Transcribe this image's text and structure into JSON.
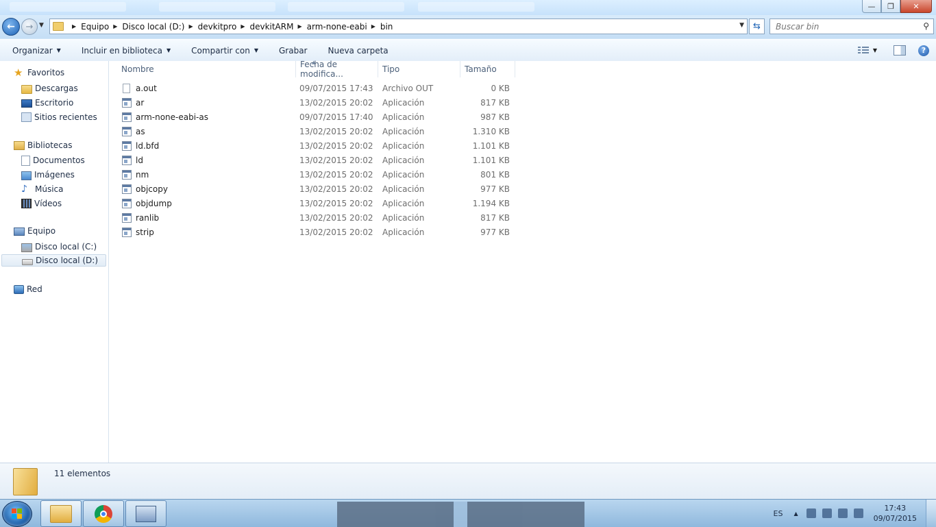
{
  "window": {
    "controls": {
      "minimize": "—",
      "maximize": "❐",
      "close": "✕"
    }
  },
  "nav": {
    "back_glyph": "←",
    "forward_glyph": "→",
    "breadcrumb": [
      "Equipo",
      "Disco local (D:)",
      "devkitpro",
      "devkitARM",
      "arm-none-eabi",
      "bin"
    ],
    "search_placeholder": "Buscar bin"
  },
  "toolbar": {
    "organize": "Organizar",
    "include_library": "Incluir en biblioteca",
    "share_with": "Compartir con",
    "burn": "Grabar",
    "new_folder": "Nueva carpeta",
    "help": "?"
  },
  "sidebar": {
    "favorites": {
      "label": "Favoritos",
      "items": [
        "Descargas",
        "Escritorio",
        "Sitios recientes"
      ]
    },
    "libraries": {
      "label": "Bibliotecas",
      "items": [
        "Documentos",
        "Imágenes",
        "Música",
        "Vídeos"
      ]
    },
    "computer": {
      "label": "Equipo",
      "items": [
        "Disco local (C:)",
        "Disco local (D:)"
      ],
      "selected": "Disco local (D:)"
    },
    "network": {
      "label": "Red"
    }
  },
  "columns": {
    "name": "Nombre",
    "date": "Fecha de modifica...",
    "type": "Tipo",
    "size": "Tamaño"
  },
  "files": [
    {
      "name": "a.out",
      "date": "09/07/2015 17:43",
      "type": "Archivo OUT",
      "size": "0 KB",
      "icon": "file-icon"
    },
    {
      "name": "ar",
      "date": "13/02/2015 20:02",
      "type": "Aplicación",
      "size": "817 KB",
      "icon": "application-icon"
    },
    {
      "name": "arm-none-eabi-as",
      "date": "09/07/2015 17:40",
      "type": "Aplicación",
      "size": "987 KB",
      "icon": "application-icon"
    },
    {
      "name": "as",
      "date": "13/02/2015 20:02",
      "type": "Aplicación",
      "size": "1.310 KB",
      "icon": "application-icon"
    },
    {
      "name": "ld.bfd",
      "date": "13/02/2015 20:02",
      "type": "Aplicación",
      "size": "1.101 KB",
      "icon": "application-icon"
    },
    {
      "name": "ld",
      "date": "13/02/2015 20:02",
      "type": "Aplicación",
      "size": "1.101 KB",
      "icon": "application-icon"
    },
    {
      "name": "nm",
      "date": "13/02/2015 20:02",
      "type": "Aplicación",
      "size": "801 KB",
      "icon": "application-icon"
    },
    {
      "name": "objcopy",
      "date": "13/02/2015 20:02",
      "type": "Aplicación",
      "size": "977 KB",
      "icon": "application-icon"
    },
    {
      "name": "objdump",
      "date": "13/02/2015 20:02",
      "type": "Aplicación",
      "size": "1.194 KB",
      "icon": "application-icon"
    },
    {
      "name": "ranlib",
      "date": "13/02/2015 20:02",
      "type": "Aplicación",
      "size": "817 KB",
      "icon": "application-icon"
    },
    {
      "name": "strip",
      "date": "13/02/2015 20:02",
      "type": "Aplicación",
      "size": "977 KB",
      "icon": "application-icon"
    }
  ],
  "details": {
    "item_count": "11 elementos"
  },
  "taskbar": {
    "apps": [
      "explorer-icon",
      "chrome-icon",
      "application-icon"
    ],
    "language": "ES",
    "time": "17:43",
    "date": "09/07/2015"
  }
}
